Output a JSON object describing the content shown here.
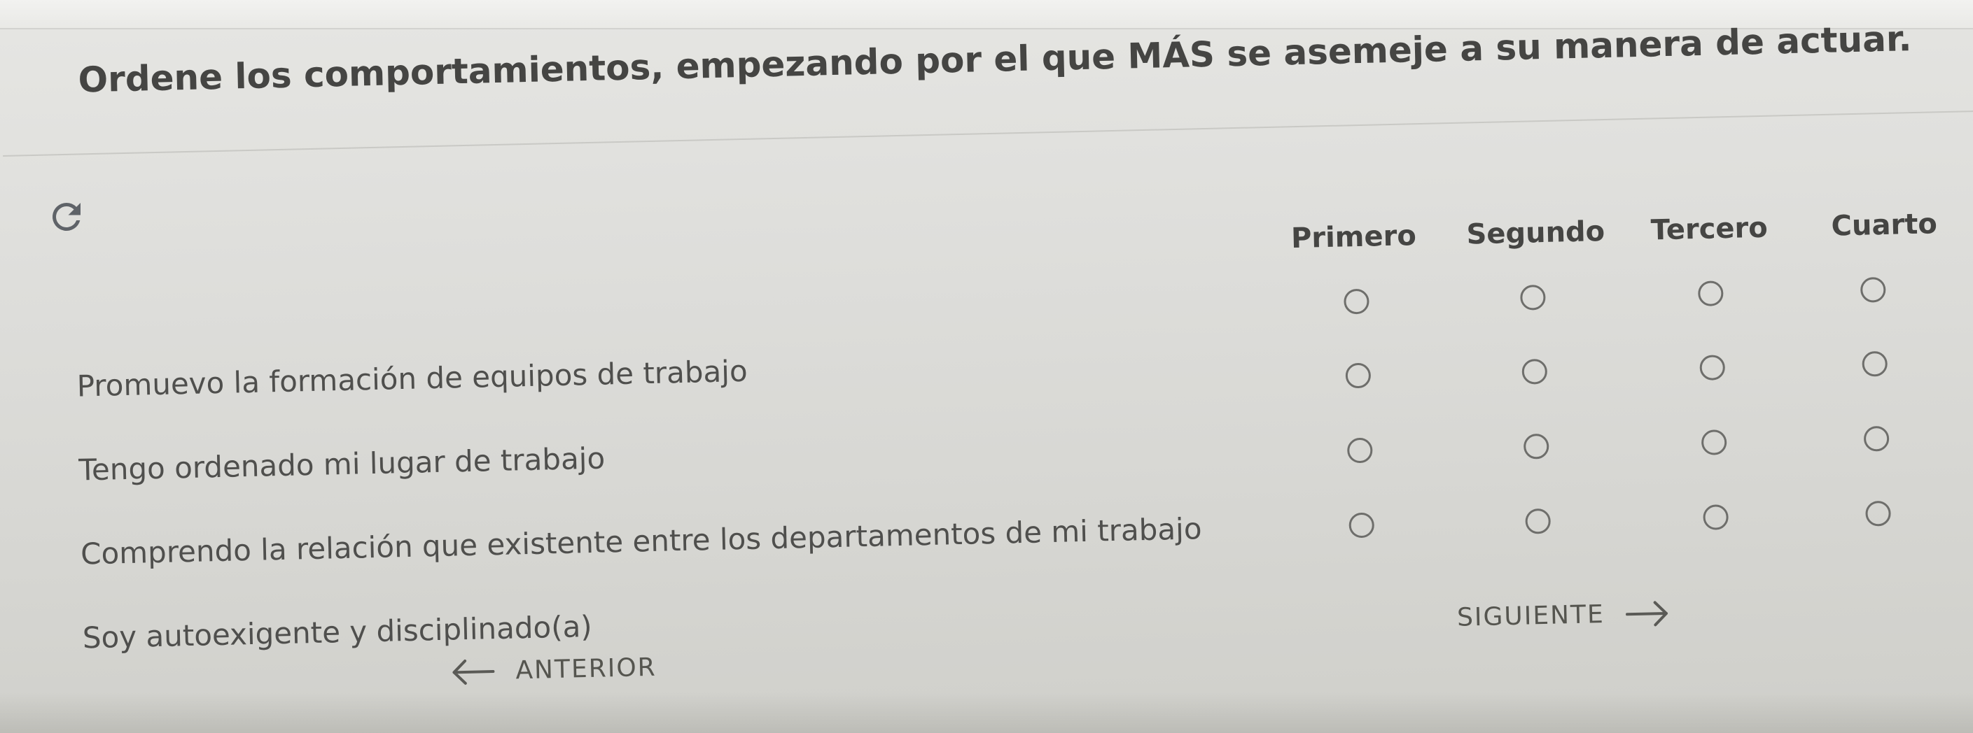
{
  "question": {
    "title": "Ordene los comportamientos, empezando por el que MÁS se asemeje a su manera de actuar."
  },
  "toolbar": {
    "reset_icon": "refresh-icon"
  },
  "columns": [
    {
      "label": "Primero"
    },
    {
      "label": "Segundo"
    },
    {
      "label": "Tercero"
    },
    {
      "label": "Cuarto"
    }
  ],
  "rows": [
    {
      "label": "Promuevo la formación de equipos de trabajo"
    },
    {
      "label": "Tengo ordenado mi lugar de trabajo"
    },
    {
      "label": "Comprendo la relación que existente entre los departamentos de mi trabajo"
    },
    {
      "label": "Soy autoexigente y disciplinado(a)"
    }
  ],
  "navigation": {
    "previous_label": "ANTERIOR",
    "next_label": "SIGUIENTE",
    "previous_icon": "arrow-left-icon",
    "next_icon": "arrow-right-icon"
  },
  "colors": {
    "background": "#dededb",
    "text": "#4a4a48",
    "radio_border": "#6e6e6b"
  }
}
